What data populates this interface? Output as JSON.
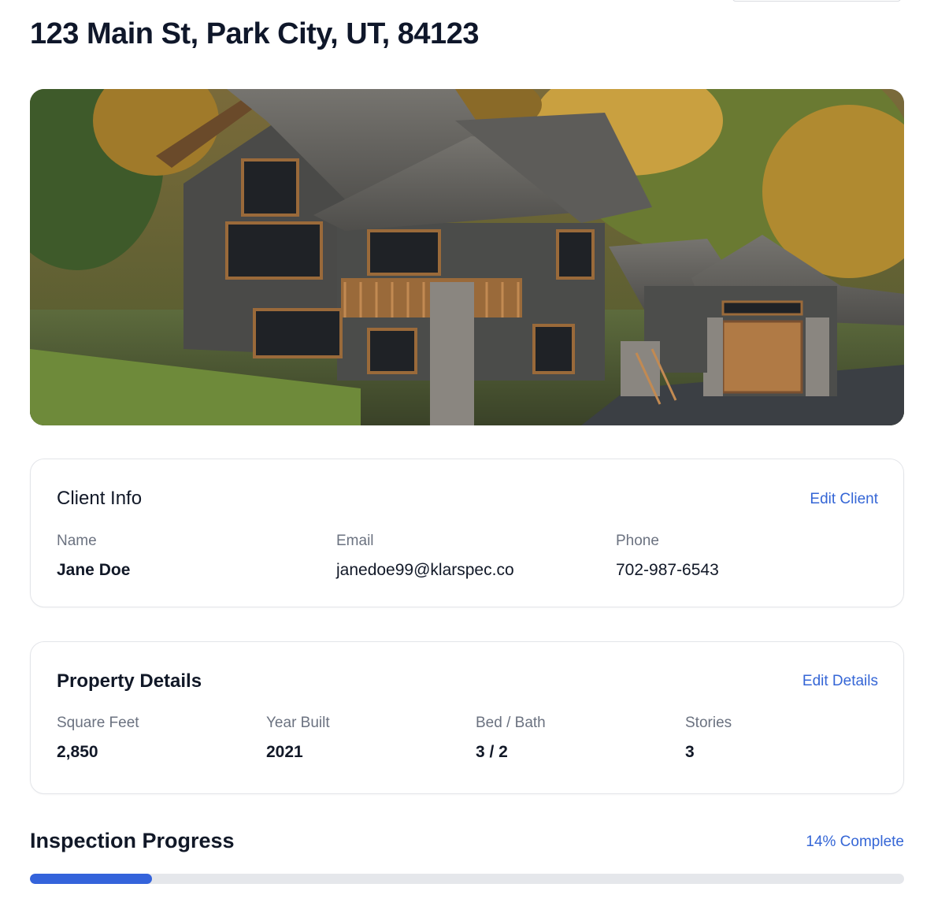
{
  "property": {
    "address": "123 Main St, Park City, UT, 84123"
  },
  "client_info": {
    "title": "Client Info",
    "edit_label": "Edit Client",
    "fields": [
      {
        "label": "Name",
        "value": "Jane Doe"
      },
      {
        "label": "Email",
        "value": "janedoe99@klarspec.co"
      },
      {
        "label": "Phone",
        "value": "702-987-6543"
      }
    ]
  },
  "property_details": {
    "title": "Property Details",
    "edit_label": "Edit Details",
    "fields": [
      {
        "label": "Square Feet",
        "value": "2,850"
      },
      {
        "label": "Year Built",
        "value": "2021"
      },
      {
        "label": "Bed / Bath",
        "value": "3 / 2"
      },
      {
        "label": "Stories",
        "value": "3"
      }
    ]
  },
  "inspection": {
    "title": "Inspection Progress",
    "progress_label": "14% Complete",
    "progress_fraction": 0.14
  },
  "colors": {
    "accent": "#3566d6",
    "progress_fill": "#3463db",
    "progress_track": "#e5e7eb"
  }
}
